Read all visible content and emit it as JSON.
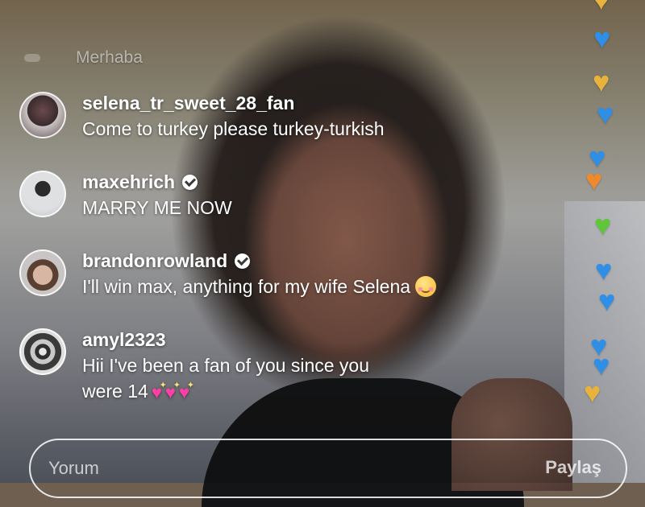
{
  "system_message": "Merhaba",
  "comments": [
    {
      "username": "selena_tr_sweet_28_fan",
      "text": "Come to turkey please turkey-turkish",
      "verified": false
    },
    {
      "username": "maxehrich",
      "text": "MARRY ME NOW",
      "verified": true
    },
    {
      "username": "brandonrowland",
      "text": "I'll win max, anything for my wife Selena",
      "verified": true,
      "emoji_icon": "smiling-face-icon"
    },
    {
      "username": "amyl2323",
      "text_line1": "Hii I've been a fan of you since you",
      "text_line2": "were 14",
      "verified": false,
      "emoji_icon": "sparkling-heart-icon"
    }
  ],
  "comment_input": {
    "placeholder": "Yorum",
    "action_label": "Paylaş"
  },
  "colors": {
    "heart_blue": "#2f8fe6",
    "heart_gold": "#e8b33c",
    "heart_orange": "#ef8a2c",
    "heart_green": "#5fc63a"
  }
}
